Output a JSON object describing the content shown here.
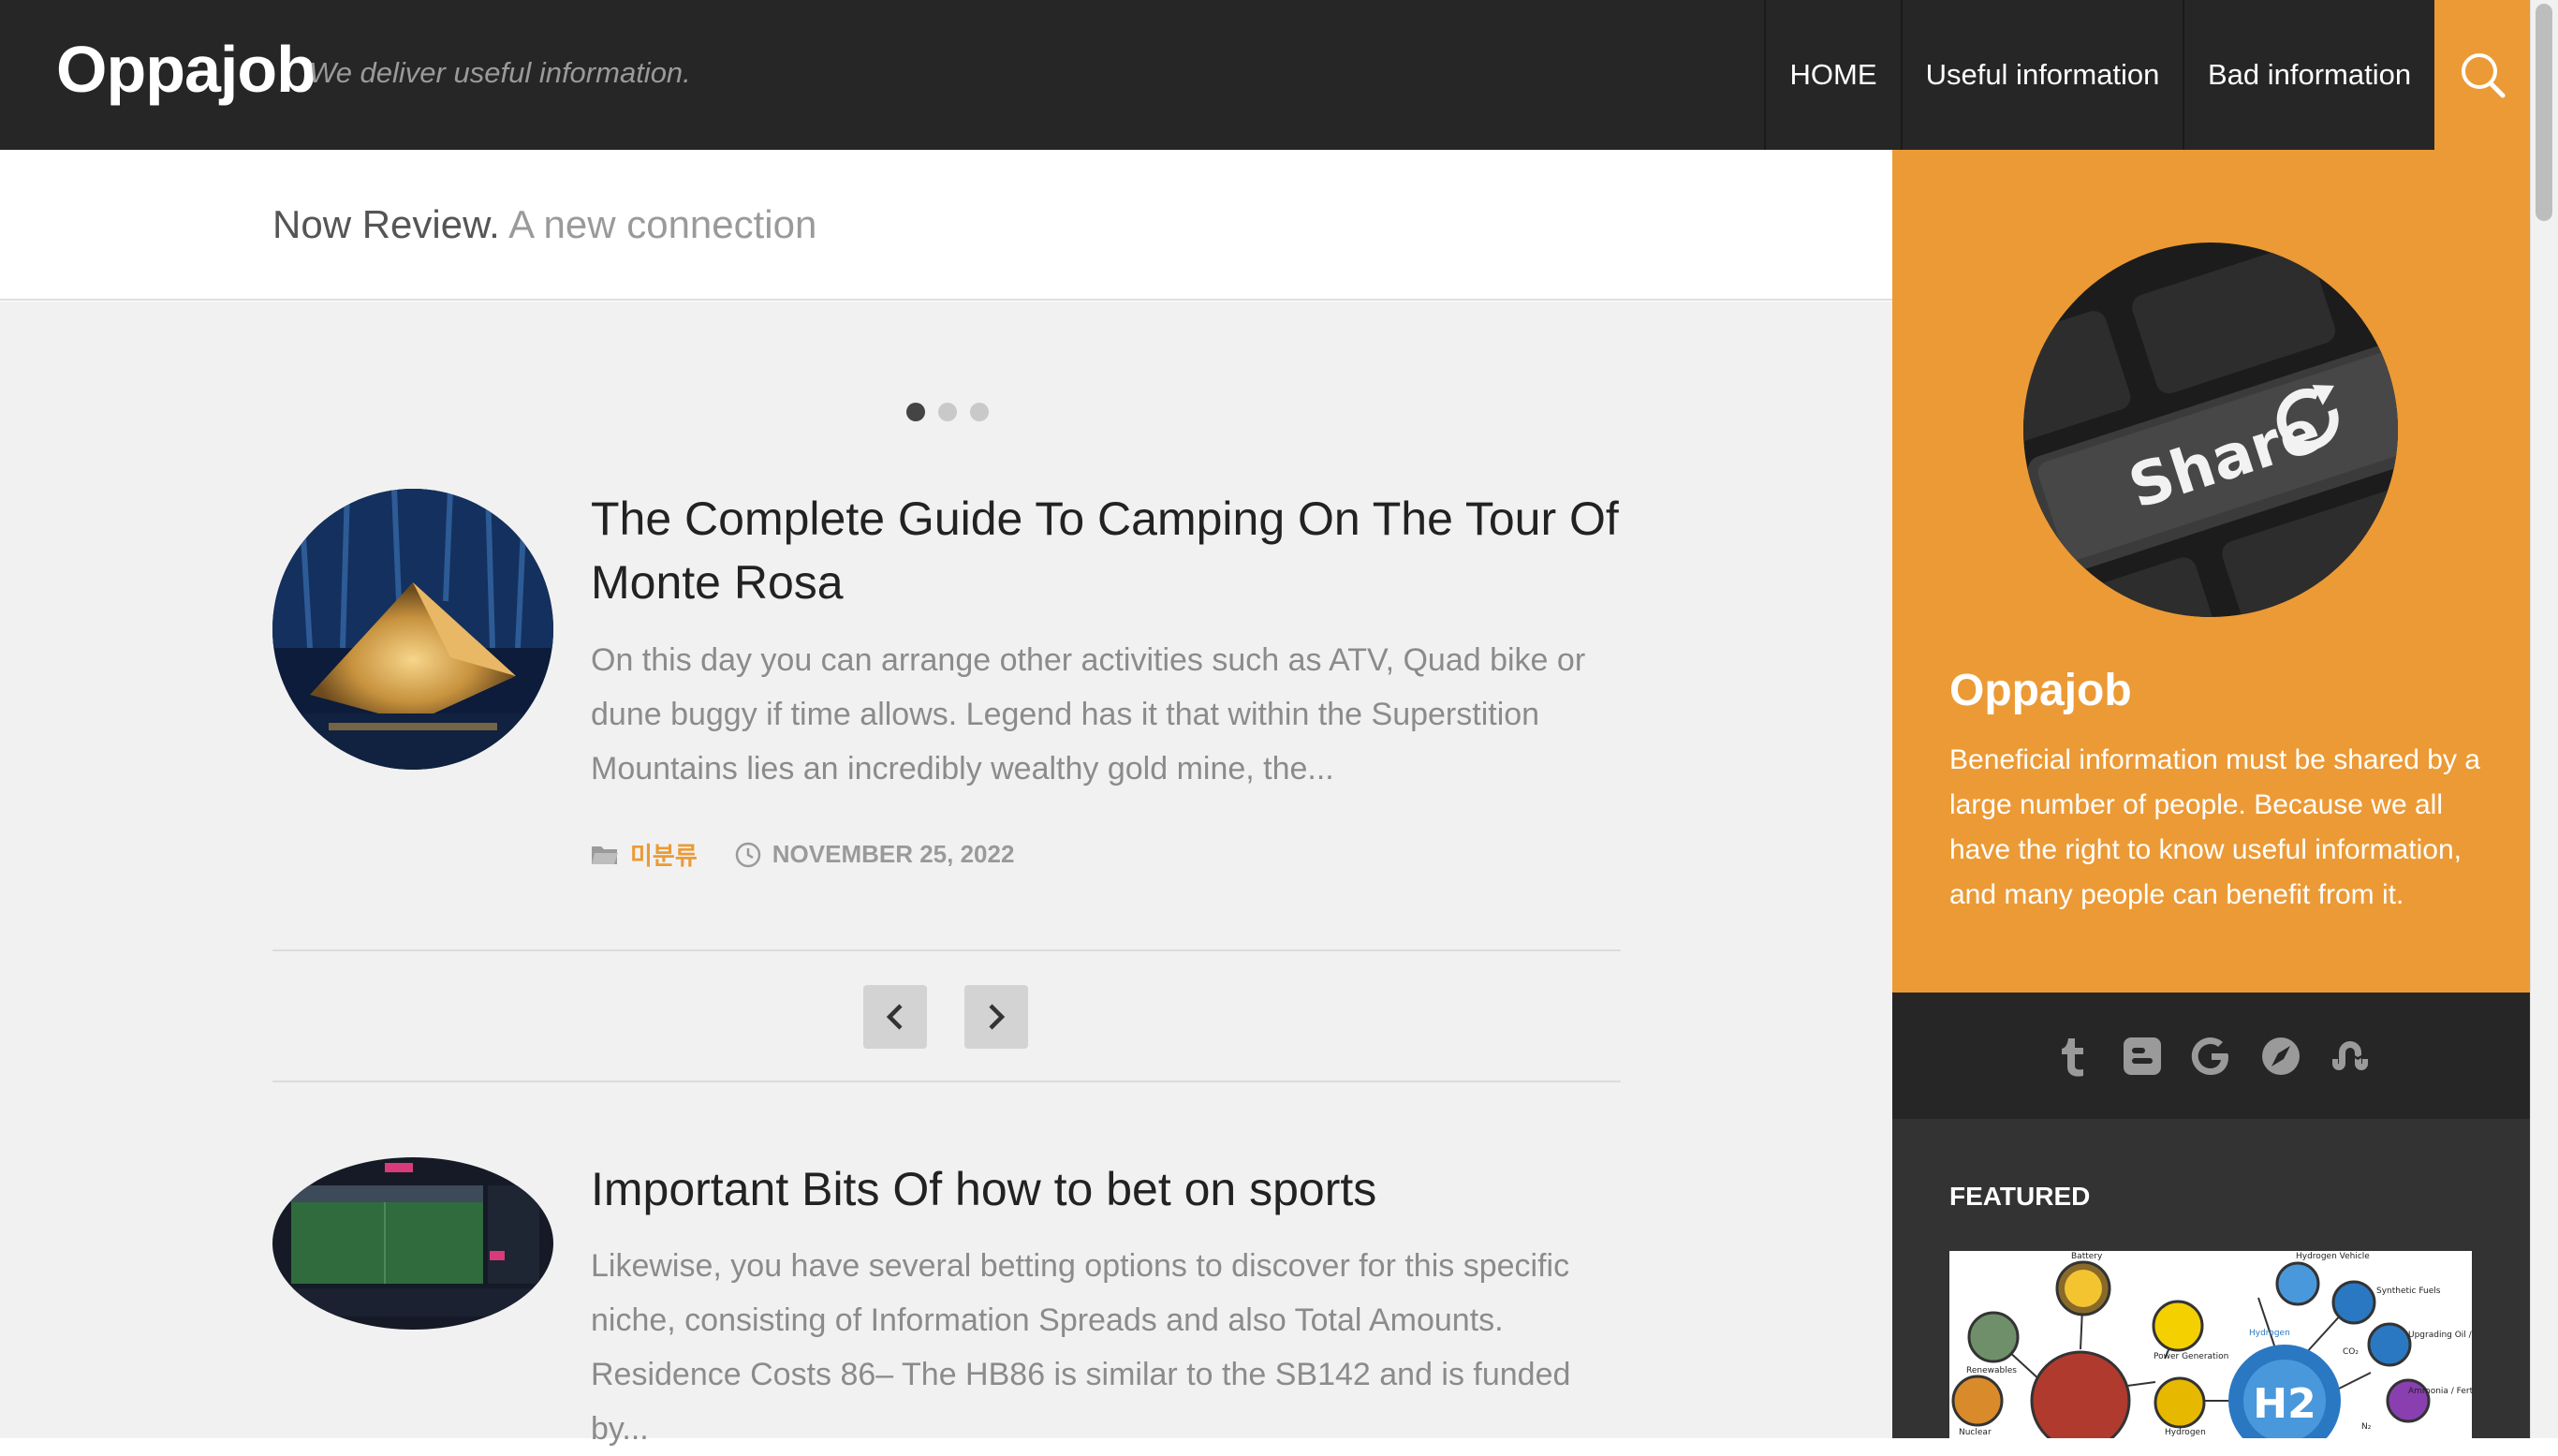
{
  "header": {
    "logo": "Oppajob",
    "tagline": "We deliver useful information.",
    "nav": [
      "HOME",
      "Useful information",
      "Bad information"
    ]
  },
  "subheader": {
    "title": "Now Review.",
    "subtitle": "A new connection"
  },
  "slider": {
    "dots": 3,
    "active": 0
  },
  "posts": [
    {
      "title": "The Complete Guide To Camping On The Tour Of Monte Rosa",
      "excerpt": "On this day you can arrange other activities such as ATV, Quad bike or dune buggy if time allows. Legend has it that within the Superstition Mountains lies an incredibly wealthy gold mine, the...",
      "category": "미분류",
      "date": "NOVEMBER 25, 2022"
    },
    {
      "title": "Important Bits Of how to bet on sports",
      "excerpt": "Likewise, you have several betting options to discover for this specific niche, consisting of Information Spreads and also Total Amounts. Residence Costs 86– The HB86 is similar to the SB142 and is funded by..."
    }
  ],
  "sidebar": {
    "name": "Oppajob",
    "description": "Beneficial information must be shared by a large number of people. Because we all have the right to know useful information, and many people can benefit from it.",
    "avatar_text": "Share",
    "social": [
      "tumblr-icon",
      "blogger-icon",
      "google-icon",
      "compass-icon",
      "stumbleupon-icon"
    ],
    "featured_label": "FEATURED",
    "featured_image_labels": [
      "Battery",
      "Hydrogen Vehicle",
      "Synthetic Fuels",
      "Renewables",
      "Power Generation",
      "Hydrogen",
      "Upgrading Oil / Biomass",
      "Ammonia / Fertilizer",
      "Nuclear",
      "Hydrogen",
      "CO₂",
      "N₂",
      "H2"
    ]
  },
  "colors": {
    "accent": "#ec9a35",
    "header_bg": "#262626",
    "content_bg": "#f1f1f1"
  }
}
